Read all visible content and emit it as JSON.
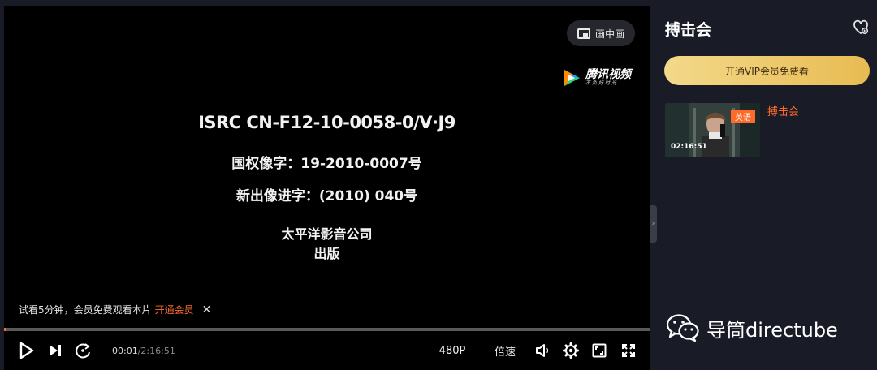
{
  "player": {
    "pip_label": "画中画",
    "logo": {
      "name": "腾讯视频",
      "slogan": "不负好时光"
    },
    "credits": [
      "ISRC CN-F12-10-0058-0/V·J9",
      "国权像字：19-2010-0007号",
      "新出像进字：(2010) 040号",
      "太平洋影音公司",
      "出版"
    ],
    "trial": {
      "text": "试看5分钟，会员免费观看本片",
      "link": "开通会员",
      "close": "✕"
    },
    "progress_fraction": 0.0001,
    "controls": {
      "current_time": "00:01",
      "separator": "/",
      "duration": "2:16:51",
      "quality": "480P",
      "speed": "倍速"
    },
    "colors": {
      "accent": "#ff6a2a",
      "vip_gold": "#f3d98a"
    }
  },
  "panel": {
    "title": "搏击会",
    "vip_button": "开通VIP会员免费看",
    "playlist": [
      {
        "title": "搏击会",
        "badge": "英语",
        "duration": "02:16:51"
      }
    ]
  },
  "watermark": {
    "text": "导筒directube",
    "icon": "wechat-icon"
  }
}
